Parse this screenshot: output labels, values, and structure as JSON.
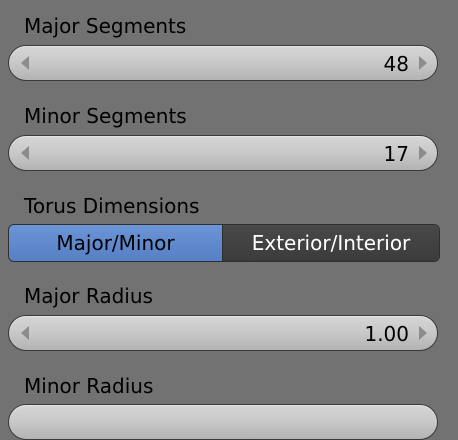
{
  "fields": [
    {
      "label": "Major Segments",
      "value": "48"
    },
    {
      "label": "Minor Segments",
      "value": "17"
    },
    {
      "label": "Major Radius",
      "value": "1.00"
    },
    {
      "label": "Minor Radius",
      "value": ""
    }
  ],
  "torus_dimensions": {
    "label": "Torus Dimensions",
    "options": [
      "Major/Minor",
      "Exterior/Interior"
    ],
    "selected": "Major/Minor"
  },
  "colors": {
    "background": "#727272",
    "selected_accent": "#5680c4",
    "unselected_option": "#3c3c3c"
  }
}
